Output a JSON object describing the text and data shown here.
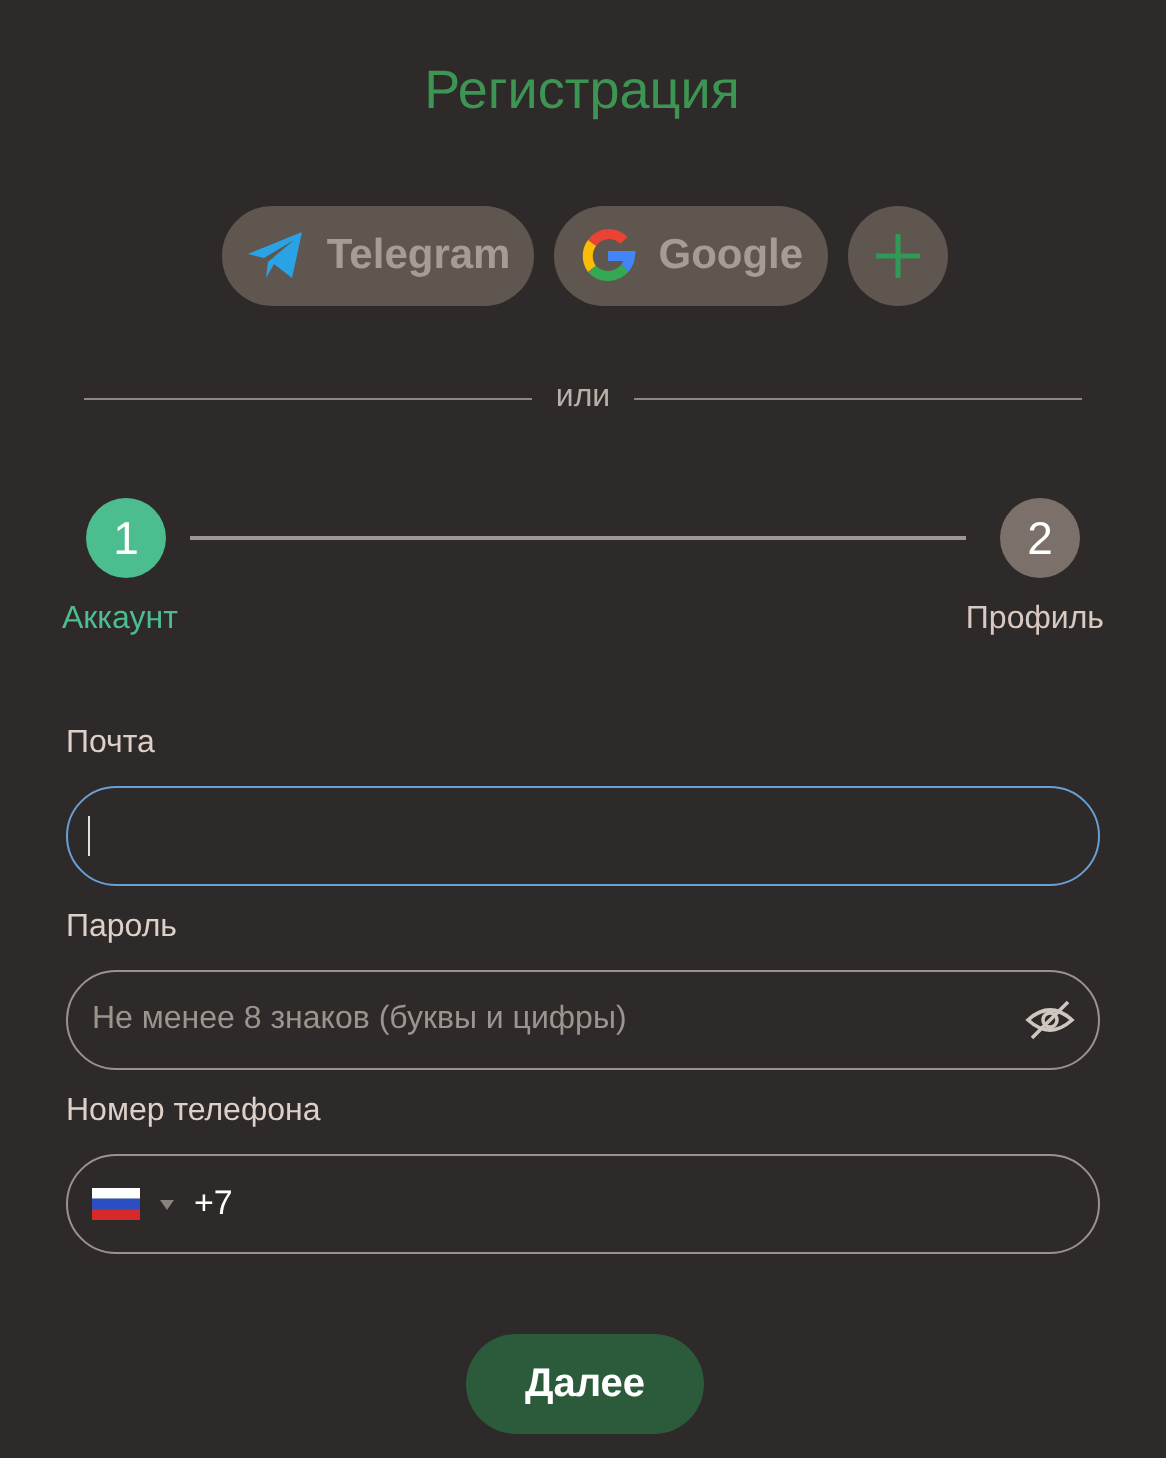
{
  "title": "Регистрация",
  "social": [
    {
      "kind": "telegram",
      "label": "Telegram"
    },
    {
      "kind": "google",
      "label": "Google"
    },
    {
      "kind": "more"
    }
  ],
  "divider": "или",
  "steps": [
    {
      "number": "1",
      "label": "Аккаунт",
      "selected": true
    },
    {
      "number": "2",
      "label": "Профиль",
      "selected": false
    }
  ],
  "fields": [
    {
      "kind": "email",
      "label": "Почта",
      "focused": true
    },
    {
      "kind": "password",
      "label": "Пароль",
      "placeholder": "Не менее 8 знаков (буквы и цифры)",
      "focused": false
    },
    {
      "kind": "phone",
      "label": "Номер телефона",
      "value": "+7",
      "focused": false
    }
  ],
  "submit": "Далее"
}
